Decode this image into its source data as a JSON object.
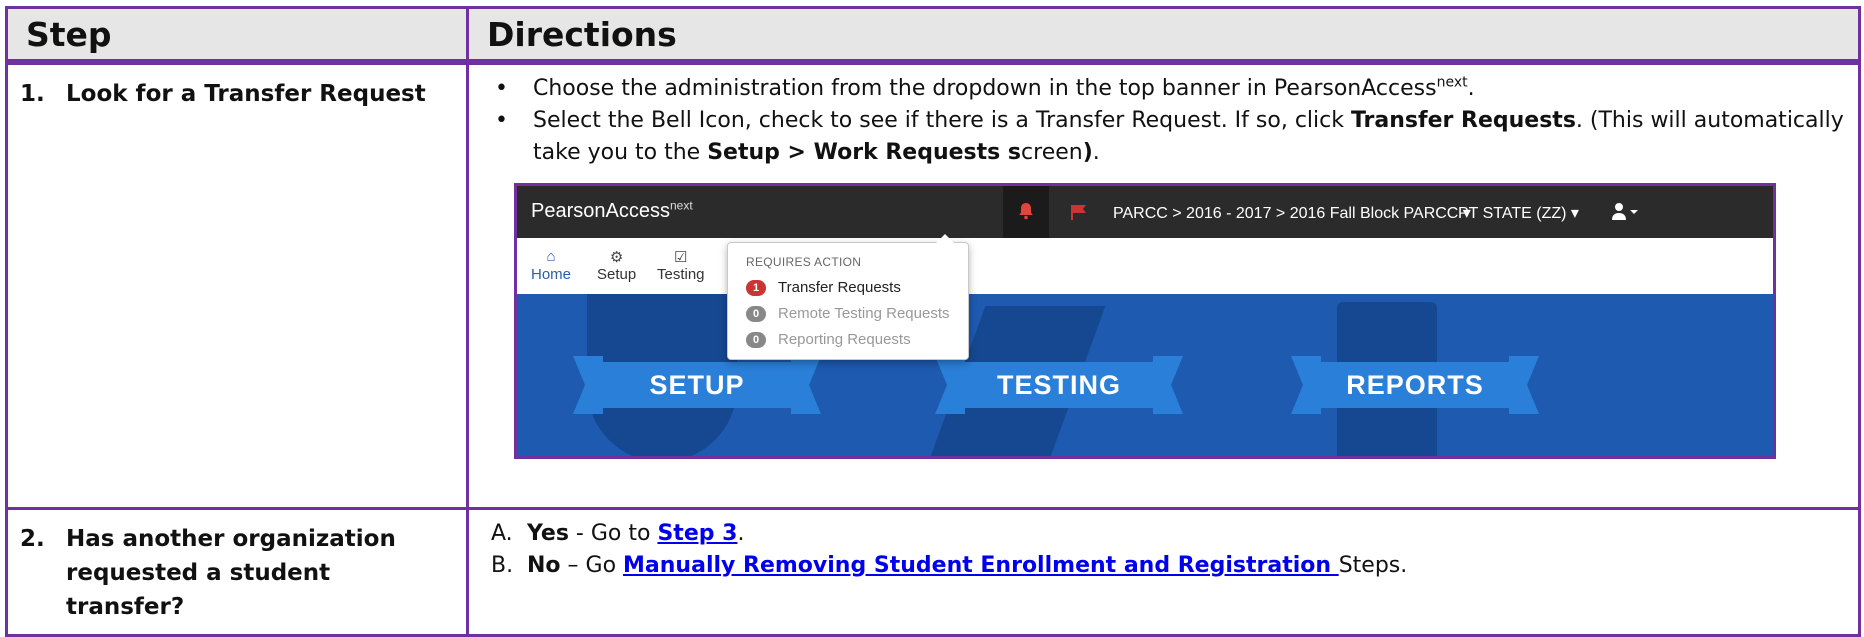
{
  "table": {
    "col_step": "Step",
    "col_directions": "Directions"
  },
  "row1": {
    "num": "1.",
    "step": "Look for a Transfer Request",
    "bullet1_pre": "Choose the administration from the dropdown in the top banner in PearsonAccess",
    "bullet1_sup": "next",
    "bullet1_post": ".",
    "bullet2_a": "Select the Bell Icon, check to see if there is a Transfer Request. If so, click ",
    "bullet2_b": "Transfer Requests",
    "bullet2_c": ". (This will automatically take you to the ",
    "bullet2_d": "Setup > Work Requests s",
    "bullet2_e": "creen",
    "bullet2_f": ")",
    "bullet2_g": "."
  },
  "screenshot": {
    "brand": "PearsonAccess",
    "brand_sup": "next",
    "breadcrumb": "PARCC > 2016 - 2017 > 2016 Fall Block PARCC ▾",
    "org": "PT STATE (ZZ) ▾",
    "nav": {
      "home": "Home",
      "setup": "Setup",
      "testing": "Testing"
    },
    "dropdown": {
      "title": "REQUIRES ACTION",
      "items": [
        {
          "count": "1",
          "label": "Transfer Requests"
        },
        {
          "count": "0",
          "label": "Remote Testing Requests"
        },
        {
          "count": "0",
          "label": "Reporting Requests"
        }
      ]
    },
    "ribbons": {
      "setup": "SETUP",
      "testing": "TESTING",
      "reports": "REPORTS"
    },
    "colors": {
      "topbar": "#2b2b2b",
      "hero": "#1d5ab0",
      "ribbon": "#2a7fd8",
      "badge_active": "#cc3333",
      "bell": "#e0443c"
    }
  },
  "row2": {
    "num": "2.",
    "step": "Has another organization requested a student transfer?",
    "a_letter": "A.",
    "a_bold": "Yes",
    "a_text": " - Go to ",
    "a_link": "Step 3",
    "a_end": ".",
    "b_letter": "B.",
    "b_bold": "No",
    "b_text": " – Go ",
    "b_link": "Manually Removing Student Enrollment and Registration ",
    "b_end": "Steps."
  },
  "border_color": "#7030a0"
}
